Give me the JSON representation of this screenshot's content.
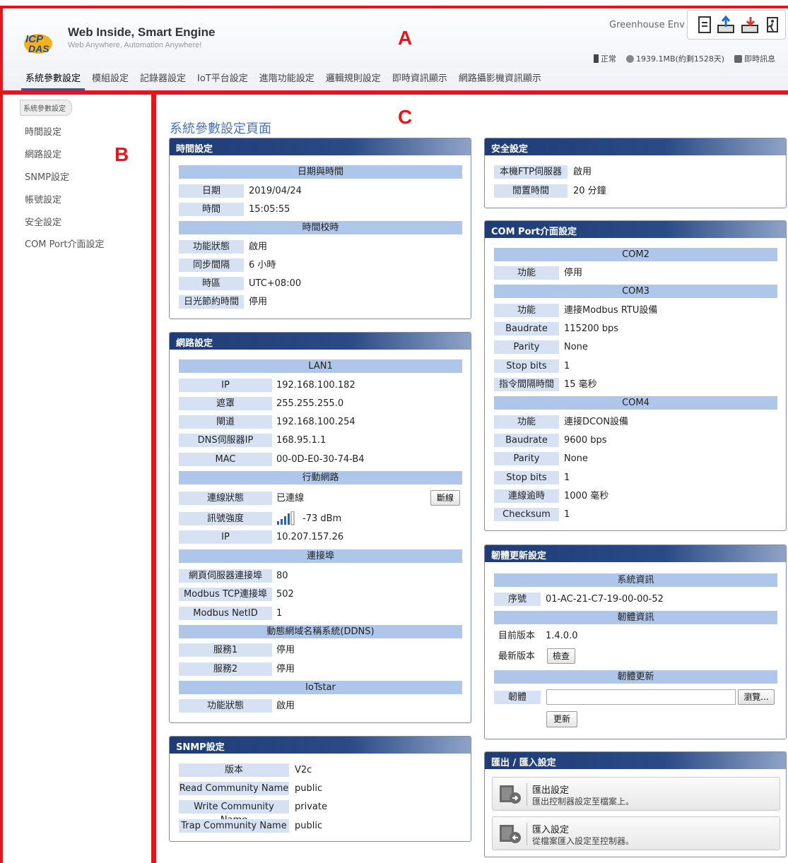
{
  "header": {
    "brand_title": "Web Inside, Smart Engine",
    "brand_sub": "Web Anywhere, Automation Anywhere!",
    "device_name": "Greenhouse Env",
    "status": {
      "state": "正常",
      "storage": "1939.1MB(約剩1528天)",
      "message": "即時訊息"
    }
  },
  "nav": [
    "系統參數設定",
    "模組設定",
    "記錄器設定",
    "IoT平台設定",
    "進階功能設定",
    "邏輯規則設定",
    "即時資訊顯示",
    "網路攝影機資訊顯示"
  ],
  "sidebar": {
    "crumb": "系統參數設定",
    "items": [
      "時間設定",
      "網路設定",
      "SNMP設定",
      "帳號設定",
      "安全設定",
      "COM Port介面設定"
    ]
  },
  "annotations": [
    "A",
    "B",
    "C"
  ],
  "main": {
    "page_title": "系統參數設定頁面",
    "time": {
      "title": "時間設定",
      "sec1": "日期與時間",
      "date_l": "日期",
      "date_v": "2019/04/24",
      "time_l": "時間",
      "time_v": "15:05:55",
      "sec2": "時間校時",
      "func_l": "功能狀態",
      "func_v": "啟用",
      "sync_l": "同步間隔",
      "sync_v": "6 小時",
      "tz_l": "時區",
      "tz_v": "UTC+08:00",
      "dst_l": "日光節約時間",
      "dst_v": "停用"
    },
    "network": {
      "title": "網路設定",
      "lan": "LAN1",
      "ip_l": "IP",
      "ip_v": "192.168.100.182",
      "mask_l": "遮罩",
      "mask_v": "255.255.255.0",
      "gw_l": "閘道",
      "gw_v": "192.168.100.254",
      "dns_l": "DNS伺服器IP",
      "dns_v": "168.95.1.1",
      "mac_l": "MAC",
      "mac_v": "00-0D-E0-30-74-B4",
      "mobile": "行動網路",
      "conn_l": "連線狀態",
      "conn_v": "已連線",
      "disconnect": "斷線",
      "sig_l": "訊號強度",
      "sig_v": "-73 dBm",
      "mip_l": "IP",
      "mip_v": "10.207.157.26",
      "ports": "連接埠",
      "web_l": "網頁伺服器連接埠",
      "web_v": "80",
      "mb_l": "Modbus TCP連接埠",
      "mb_v": "502",
      "nid_l": "Modbus NetID",
      "nid_v": "1",
      "ddns": "動態網域名稱系統(DDNS)",
      "s1_l": "服務1",
      "s1_v": "停用",
      "s2_l": "服務2",
      "s2_v": "停用",
      "iot": "IoTstar",
      "iot_l": "功能狀態",
      "iot_v": "啟用"
    },
    "snmp": {
      "title": "SNMP設定",
      "ver_l": "版本",
      "ver_v": "V2c",
      "rc_l": "Read Community Name",
      "rc_v": "public",
      "wc_l": "Write Community Name",
      "wc_v": "private",
      "tc_l": "Trap Community Name",
      "tc_v": "public"
    },
    "security": {
      "title": "安全設定",
      "ftp_l": "本機FTP伺服器",
      "ftp_v": "啟用",
      "idle_l": "閒置時間",
      "idle_v": "20 分鐘"
    },
    "com": {
      "title": "COM Port介面設定",
      "com2": "COM2",
      "c2f_l": "功能",
      "c2f_v": "停用",
      "com3": "COM3",
      "c3f_l": "功能",
      "c3f_v": "連接Modbus RTU設備",
      "c3b_l": "Baudrate",
      "c3b_v": "115200 bps",
      "c3p_l": "Parity",
      "c3p_v": "None",
      "c3s_l": "Stop bits",
      "c3s_v": "1",
      "c3i_l": "指令間隔時間",
      "c3i_v": "15 毫秒",
      "com4": "COM4",
      "c4f_l": "功能",
      "c4f_v": "連接DCON設備",
      "c4b_l": "Baudrate",
      "c4b_v": "9600 bps",
      "c4p_l": "Parity",
      "c4p_v": "None",
      "c4s_l": "Stop bits",
      "c4s_v": "1",
      "c4t_l": "連線逾時",
      "c4t_v": "1000 毫秒",
      "c4c_l": "Checksum",
      "c4c_v": "1"
    },
    "firmware": {
      "title": "韌體更新設定",
      "sys": "系統資訊",
      "sn_l": "序號",
      "sn_v": "01-AC-21-C7-19-00-00-52",
      "fwinfo": "韌體資訊",
      "cur_l": "目前版本",
      "cur_v": "1.4.0.0",
      "new_l": "最新版本",
      "check": "檢查",
      "upd": "韌體更新",
      "fw_l": "韌體",
      "browse": "瀏覽...",
      "update": "更新"
    },
    "export": {
      "title": "匯出 / 匯入設定",
      "exp_t": "匯出設定",
      "exp_d": "匯出控制器設定至檔案上。",
      "imp_t": "匯入設定",
      "imp_d": "從檔案匯入設定至控制器。"
    }
  }
}
